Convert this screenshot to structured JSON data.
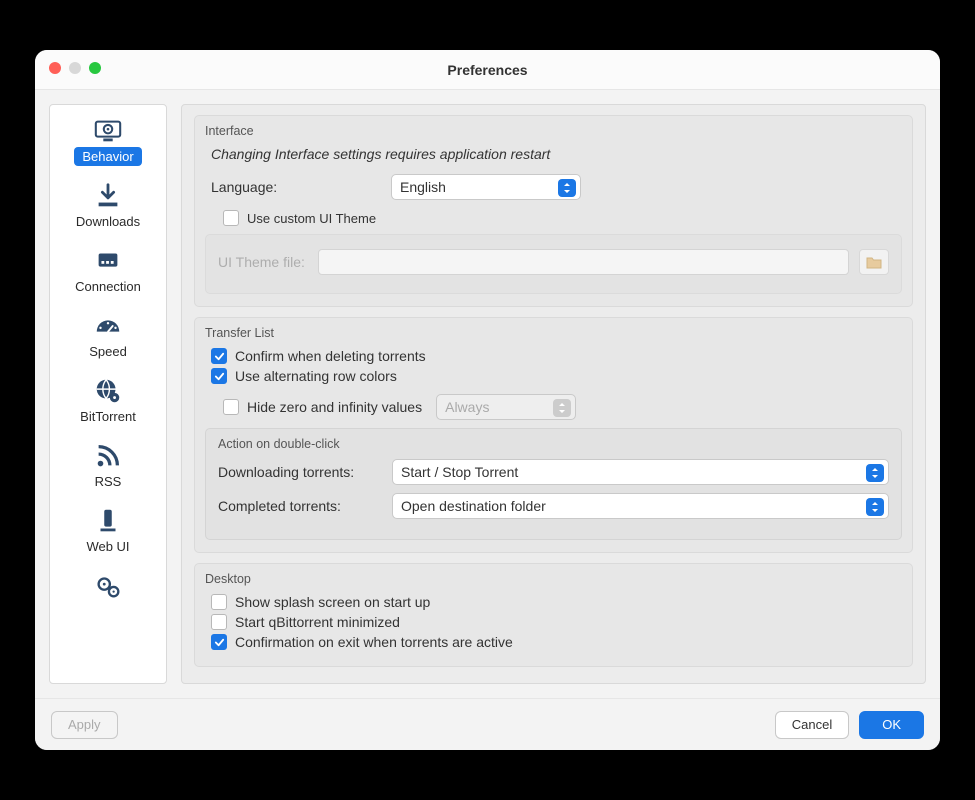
{
  "window": {
    "title": "Preferences"
  },
  "sidebar": {
    "items": [
      {
        "label": "Behavior"
      },
      {
        "label": "Downloads"
      },
      {
        "label": "Connection"
      },
      {
        "label": "Speed"
      },
      {
        "label": "BitTorrent"
      },
      {
        "label": "RSS"
      },
      {
        "label": "Web UI"
      },
      {
        "label": ""
      }
    ],
    "active_index": 0
  },
  "interface": {
    "title": "Interface",
    "notice": "Changing Interface settings requires application restart",
    "language_label": "Language:",
    "language_value": "English",
    "use_custom_theme_label": "Use custom UI Theme",
    "use_custom_theme_checked": false,
    "theme_file_label": "UI Theme file:"
  },
  "transfer_list": {
    "title": "Transfer List",
    "confirm_delete_label": "Confirm when deleting torrents",
    "confirm_delete_checked": true,
    "alt_rows_label": "Use alternating row colors",
    "alt_rows_checked": true,
    "hide_zero_label": "Hide zero and infinity values",
    "hide_zero_checked": false,
    "hide_zero_mode": "Always",
    "double_click_title": "Action on double-click",
    "downloading_label": "Downloading torrents:",
    "downloading_value": "Start / Stop Torrent",
    "completed_label": "Completed torrents:",
    "completed_value": "Open destination folder"
  },
  "desktop": {
    "title": "Desktop",
    "splash_label": "Show splash screen on start up",
    "splash_checked": false,
    "minimized_label": "Start qBittorrent minimized",
    "minimized_checked": false,
    "confirm_exit_label": "Confirmation on exit when torrents are active",
    "confirm_exit_checked": true
  },
  "footer": {
    "apply": "Apply",
    "cancel": "Cancel",
    "ok": "OK"
  }
}
